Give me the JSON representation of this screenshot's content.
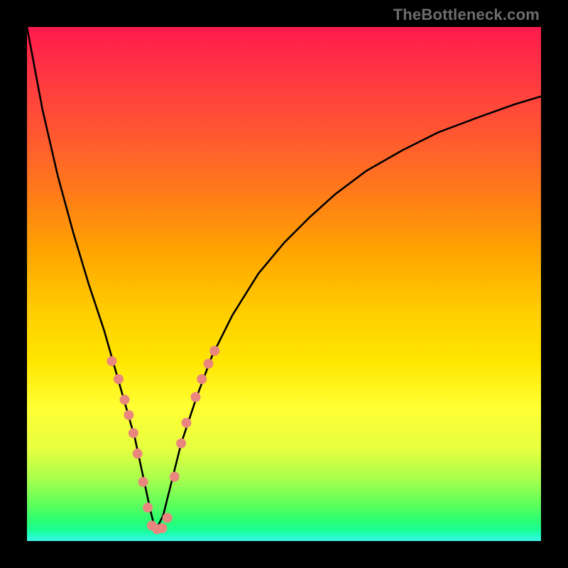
{
  "watermark": "TheBottleneck.com",
  "chart_data": {
    "type": "line",
    "title": "",
    "xlabel": "",
    "ylabel": "",
    "xlim": [
      0,
      100
    ],
    "ylim": [
      0,
      100
    ],
    "notch_x": 25,
    "series": [
      {
        "name": "curve",
        "x": [
          0,
          3,
          6,
          9,
          12,
          15,
          17,
          19,
          21,
          22.5,
          24,
          25,
          26.5,
          28,
          30,
          33,
          36,
          40,
          45,
          50,
          55,
          60,
          66,
          73,
          80,
          88,
          95,
          100
        ],
        "y": [
          100,
          84,
          71,
          60,
          50,
          41,
          34,
          27,
          20,
          13,
          6,
          2,
          5,
          11,
          19,
          28,
          36,
          44,
          52,
          58,
          63,
          67.5,
          72,
          76,
          79.5,
          82.5,
          85,
          86.5
        ]
      }
    ],
    "dots": {
      "name": "markers",
      "color": "#e9877f",
      "radius_px": 7,
      "points": [
        {
          "x": 16.5,
          "y": 35.0
        },
        {
          "x": 17.8,
          "y": 31.5
        },
        {
          "x": 19.0,
          "y": 27.5
        },
        {
          "x": 19.8,
          "y": 24.5
        },
        {
          "x": 20.7,
          "y": 21.0
        },
        {
          "x": 21.5,
          "y": 17.0
        },
        {
          "x": 22.6,
          "y": 11.5
        },
        {
          "x": 23.5,
          "y": 6.5
        },
        {
          "x": 24.3,
          "y": 3.0
        },
        {
          "x": 25.3,
          "y": 2.3
        },
        {
          "x": 26.3,
          "y": 2.5
        },
        {
          "x": 27.3,
          "y": 4.5
        },
        {
          "x": 28.7,
          "y": 12.5
        },
        {
          "x": 30.0,
          "y": 19.0
        },
        {
          "x": 31.0,
          "y": 23.0
        },
        {
          "x": 32.8,
          "y": 28.0
        },
        {
          "x": 34.0,
          "y": 31.5
        },
        {
          "x": 35.3,
          "y": 34.5
        },
        {
          "x": 36.5,
          "y": 37.0
        }
      ]
    }
  }
}
